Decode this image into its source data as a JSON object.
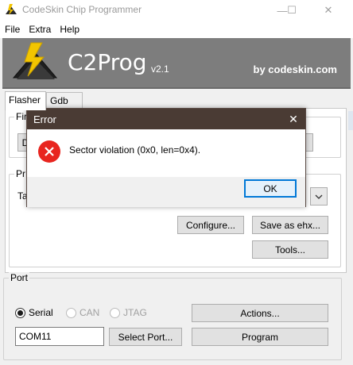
{
  "window": {
    "title": "CodeSkin Chip Programmer",
    "minimize_glyph": "—",
    "maximize_glyph": "☐",
    "close_glyph": "✕"
  },
  "menu": {
    "items": [
      "File",
      "Extra",
      "Help"
    ]
  },
  "banner": {
    "app_name": "C2Prog",
    "version": "v2.1",
    "by": "by codeskin.com",
    "background_color": "#7d7d7d"
  },
  "tabs": [
    {
      "label": "Flasher",
      "active": true
    },
    {
      "label": "Gdb",
      "active": false
    }
  ],
  "flasher": {
    "firmware_group_label_partial": "Fir",
    "browse_button_partial": "D",
    "ellipsis_button_partial": "...",
    "programming_group_label_partial": "Pr",
    "target_label_partial": "Ta",
    "dropdown_icon": "chevron-down-icon",
    "configure_button": "Configure...",
    "save_ehx_button": "Save as ehx...",
    "tools_button": "Tools..."
  },
  "port": {
    "group_label": "Port",
    "options": [
      {
        "label": "Serial",
        "selected": true,
        "enabled": true
      },
      {
        "label": "CAN",
        "selected": false,
        "enabled": false
      },
      {
        "label": "JTAG",
        "selected": false,
        "enabled": false
      }
    ],
    "port_value": "COM11",
    "select_port_button": "Select Port...",
    "actions_button": "Actions...",
    "program_button": "Program"
  },
  "dialog": {
    "title": "Error",
    "close_glyph": "✕",
    "icon": "error-icon",
    "message": "Sector violation (0x0, len=0x4).",
    "ok_button": "OK",
    "title_color": "#4a3b34",
    "error_color": "#e8251f"
  }
}
